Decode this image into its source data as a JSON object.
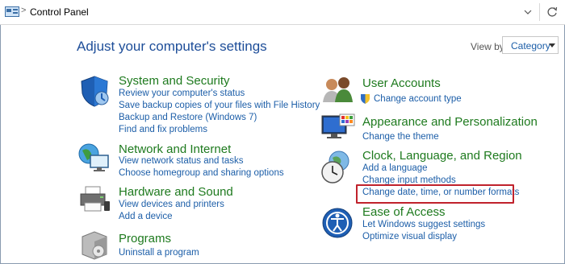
{
  "address_bar": {
    "crumb": "Control Panel",
    "separator": ">"
  },
  "heading": "Adjust your computer's settings",
  "view_by": {
    "label": "View by:",
    "value": "Category"
  },
  "categories": {
    "system": {
      "title": "System and Security",
      "links": [
        "Review your computer's status",
        "Save backup copies of your files with File History",
        "Backup and Restore (Windows 7)",
        "Find and fix problems"
      ]
    },
    "network": {
      "title": "Network and Internet",
      "links": [
        "View network status and tasks",
        "Choose homegroup and sharing options"
      ]
    },
    "hardware": {
      "title": "Hardware and Sound",
      "links": [
        "View devices and printers",
        "Add a device"
      ]
    },
    "programs": {
      "title": "Programs",
      "links": [
        "Uninstall a program"
      ]
    },
    "users": {
      "title": "User Accounts",
      "links": [
        "Change account type"
      ]
    },
    "appearance": {
      "title": "Appearance and Personalization",
      "links": [
        "Change the theme"
      ]
    },
    "clock": {
      "title": "Clock, Language, and Region",
      "links": [
        "Add a language",
        "Change input methods",
        "Change date, time, or number formats"
      ]
    },
    "ease": {
      "title": "Ease of Access",
      "links": [
        "Let Windows suggest settings",
        "Optimize visual display"
      ]
    }
  },
  "colors": {
    "title_green": "#1e7a1e",
    "link_blue": "#1c5ea8",
    "heading_blue": "#1e4e99",
    "highlight_red": "#c0222c"
  }
}
